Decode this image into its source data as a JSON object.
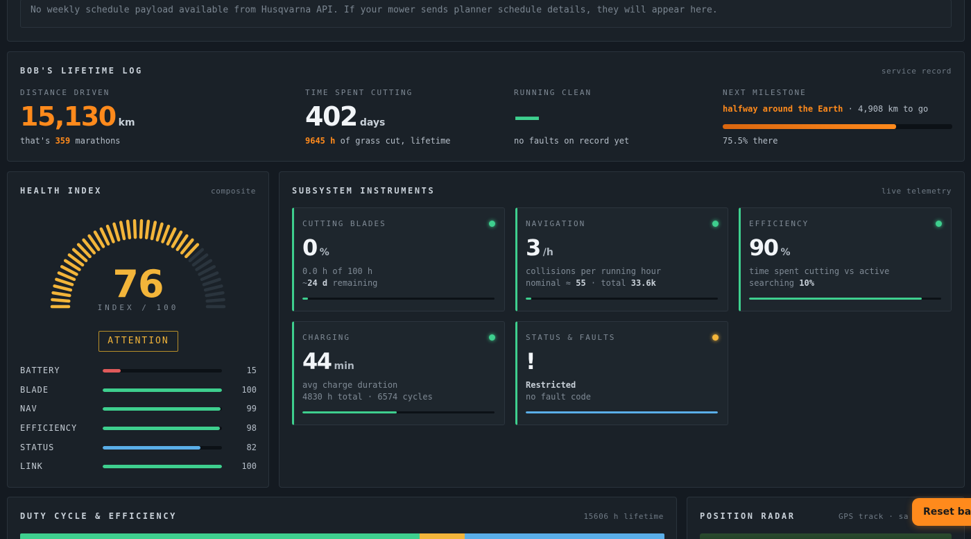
{
  "schedule": {
    "note": "No weekly schedule payload available from Husqvarna API. If your mower sends planner schedule details, they will appear here."
  },
  "lifetime": {
    "title": "BOB'S LIFETIME LOG",
    "meta": "service record",
    "distance": {
      "label": "DISTANCE DRIVEN",
      "value": "15,130",
      "unit": "km",
      "sub_pre": "that's ",
      "sub_hl": "359",
      "sub_post": " marathons"
    },
    "cutting": {
      "label": "TIME SPENT CUTTING",
      "value": "402",
      "unit": "days",
      "sub_hl": "9645 h",
      "sub_post": " of grass cut, lifetime"
    },
    "clean": {
      "label": "RUNNING CLEAN",
      "value": "—",
      "sub": "no faults on record yet"
    },
    "milestone": {
      "label": "NEXT MILESTONE",
      "target": "halfway around the Earth",
      "remaining": " · 4,908 km to go",
      "progress_pct": 75.5,
      "sub": "75.5% there"
    }
  },
  "health": {
    "title": "HEALTH INDEX",
    "meta": "composite",
    "value": "76",
    "value_num": 76,
    "caption": "INDEX / 100",
    "badge": "ATTENTION",
    "rows": [
      {
        "name": "BATTERY",
        "value": "15",
        "pct": 15,
        "color": "#e05a5a"
      },
      {
        "name": "BLADE",
        "value": "100",
        "pct": 100,
        "color": "#3ecf8e"
      },
      {
        "name": "NAV",
        "value": "99",
        "pct": 99,
        "color": "#3ecf8e"
      },
      {
        "name": "EFFICIENCY",
        "value": "98",
        "pct": 98,
        "color": "#3ecf8e"
      },
      {
        "name": "STATUS",
        "value": "82",
        "pct": 82,
        "color": "#5aaee8"
      },
      {
        "name": "LINK",
        "value": "100",
        "pct": 100,
        "color": "#3ecf8e"
      }
    ]
  },
  "instruments": {
    "title": "SUBSYSTEM INSTRUMENTS",
    "meta": "live telemetry",
    "cards": [
      {
        "label": "CUTTING BLADES",
        "value": "0",
        "unit": "%",
        "line1": "0.0 h of 100 h",
        "line2_pre": "~",
        "line2_b": "24 d",
        "line2_post": " remaining",
        "pct": 0,
        "bar_color": "#3ecf8e",
        "dot": "#3ecf8e"
      },
      {
        "label": "NAVIGATION",
        "value": "3",
        "unit": "/h",
        "line1": "collisions per running hour",
        "line2_pre": "nominal ≈ ",
        "line2_b": "55",
        "line2_post": " · total ",
        "line2_b2": "33.6k",
        "pct": 3,
        "bar_color": "#3ecf8e",
        "dot": "#3ecf8e"
      },
      {
        "label": "EFFICIENCY",
        "value": "90",
        "unit": "%",
        "line1": "time spent cutting vs active",
        "line2_pre": "searching ",
        "line2_b": "10%",
        "line2_post": "",
        "pct": 90,
        "bar_color": "#3ecf8e",
        "dot": "#3ecf8e"
      },
      {
        "label": "CHARGING",
        "value": "44",
        "unit": "min",
        "line1": "avg charge duration",
        "line2_pre": "4830 h total · 6574 cycles",
        "line2_b": "",
        "line2_post": "",
        "pct": 49,
        "bar_color": "#3ecf8e",
        "dot": "#3ecf8e"
      },
      {
        "label": "STATUS & FAULTS",
        "value": "!",
        "unit": "",
        "line1_b": "Restricted",
        "line2_pre": "no fault code",
        "line2_b": "",
        "line2_post": "",
        "pct": 100,
        "bar_color": "#5aaee8",
        "dot": "#f3b53a"
      }
    ]
  },
  "duty": {
    "title": "DUTY CYCLE & EFFICIENCY",
    "meta": "15606 h lifetime",
    "segments": [
      {
        "pct": 62,
        "color": "#3ecf8e"
      },
      {
        "pct": 7,
        "color": "#f3b53a"
      },
      {
        "pct": 31,
        "color": "#5aaee8"
      }
    ]
  },
  "radar": {
    "title": "POSITION RADAR",
    "meta": "GPS track · sa"
  },
  "actions": {
    "reset": "Reset batt"
  },
  "colors": {
    "accent": "#ff8a1c",
    "green": "#3ecf8e",
    "amber": "#f3b53a",
    "blue": "#5aaee8",
    "red": "#e05a5a"
  }
}
